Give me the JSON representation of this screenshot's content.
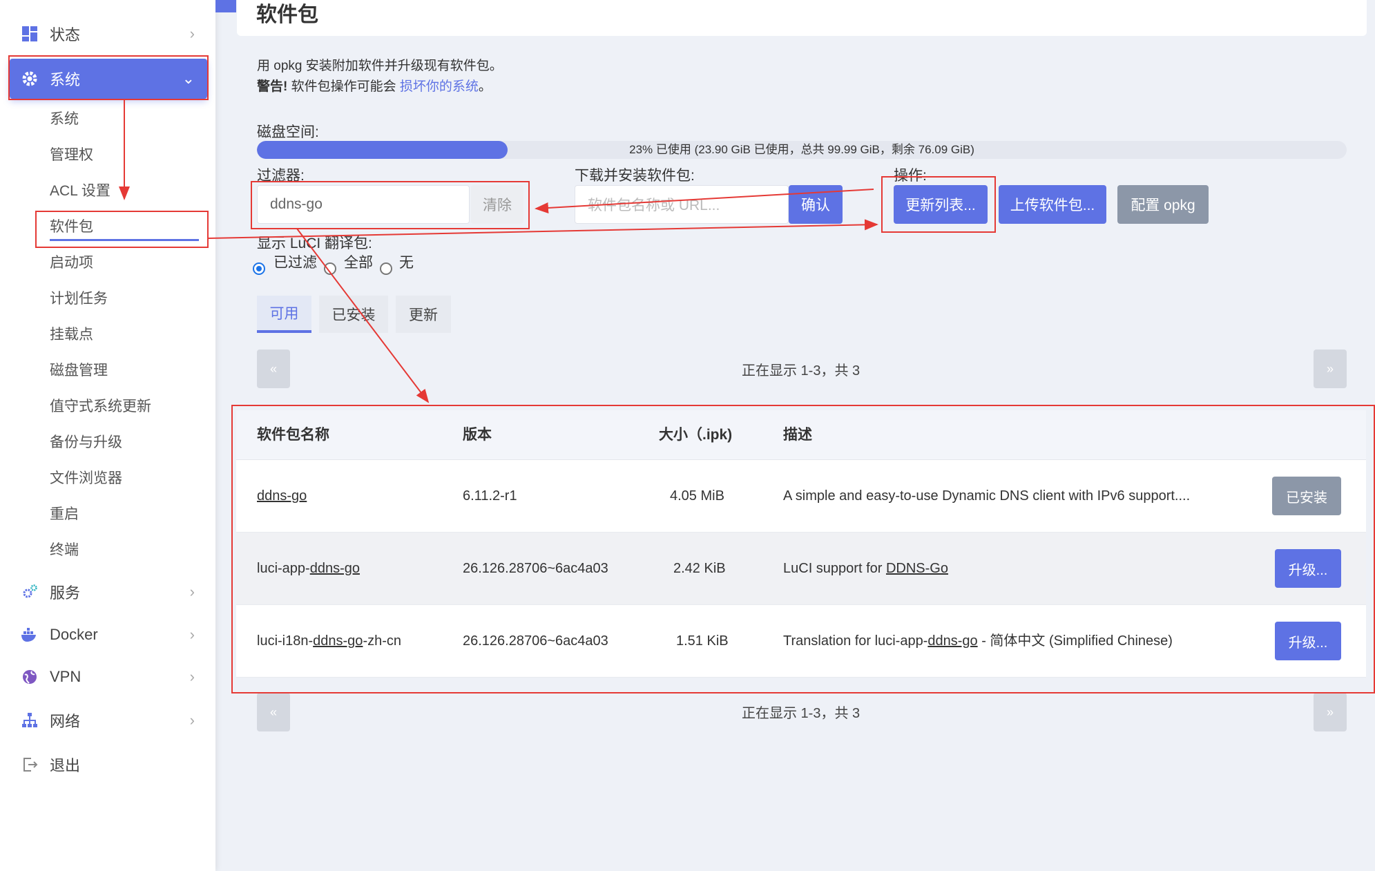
{
  "sidebar": {
    "status": "状态",
    "system": "系统",
    "sub_items": [
      "系统",
      "管理权",
      "ACL 设置",
      "软件包",
      "启动项",
      "计划任务",
      "挂载点",
      "磁盘管理",
      "值守式系统更新",
      "备份与升级",
      "文件浏览器",
      "重启",
      "终端"
    ],
    "services": "服务",
    "docker": "Docker",
    "vpn": "VPN",
    "network": "网络",
    "logout": "退出"
  },
  "page": {
    "title": "软件包",
    "desc_line1": "用 opkg 安装附加软件并升级现有软件包。",
    "warning_prefix": "警告!",
    "warning_text": " 软件包操作可能会 ",
    "warning_link": "损坏你的系统",
    "warning_end": "。"
  },
  "disk": {
    "label": "磁盘空间:",
    "used_fraction": 0.23,
    "text": "23% 已使用 (23.90 GiB 已使用，总共 99.99 GiB，剩余 76.09 GiB)"
  },
  "filter": {
    "label": "过滤器:",
    "value": "ddns-go",
    "clear_label": "清除"
  },
  "download": {
    "label": "下载并安装软件包:",
    "placeholder": "软件包名称或 URL...",
    "confirm_label": "确认"
  },
  "actions": {
    "label": "操作:",
    "update_lists": "更新列表...",
    "upload": "上传软件包...",
    "configure": "配置 opkg"
  },
  "luci_translation": {
    "label": "显示 LuCI 翻译包:",
    "options": [
      "已过滤",
      "全部",
      "无"
    ],
    "selected": "已过滤"
  },
  "tabs": [
    "可用",
    "已安装",
    "更新"
  ],
  "pager": {
    "prev": "«",
    "next": "»",
    "text": "正在显示 1-3，共 3"
  },
  "table": {
    "headers": [
      "软件包名称",
      "版本",
      "大小（.ipk)",
      "描述"
    ],
    "rows": [
      {
        "name": "ddns-go",
        "version": "6.11.2-r1",
        "size": "4.05 MiB",
        "desc": "A simple and easy-to-use Dynamic DNS client with IPv6 support....",
        "action": "已安装"
      },
      {
        "name_prefix": "luci-app-",
        "name_link": "ddns-go",
        "name_suffix": "",
        "version": "26.126.28706~6ac4a03",
        "size": "2.42 KiB",
        "desc_prefix": "LuCI support for ",
        "desc_link": "DDNS-Go",
        "desc_suffix": "",
        "action": "升级..."
      },
      {
        "name_prefix": "luci-i18n-",
        "name_link": "ddns-go",
        "name_suffix": "-zh-cn",
        "version": "26.126.28706~6ac4a03",
        "size": "1.51 KiB",
        "desc_prefix": "Translation for luci-app-",
        "desc_link": "ddns-go",
        "desc_suffix": " - 简体中文 (Simplified Chinese)",
        "action": "升级..."
      }
    ]
  },
  "colors": {
    "accent": "#5e72e4",
    "annotation": "#e53935",
    "gray_button": "#8c97a8"
  }
}
